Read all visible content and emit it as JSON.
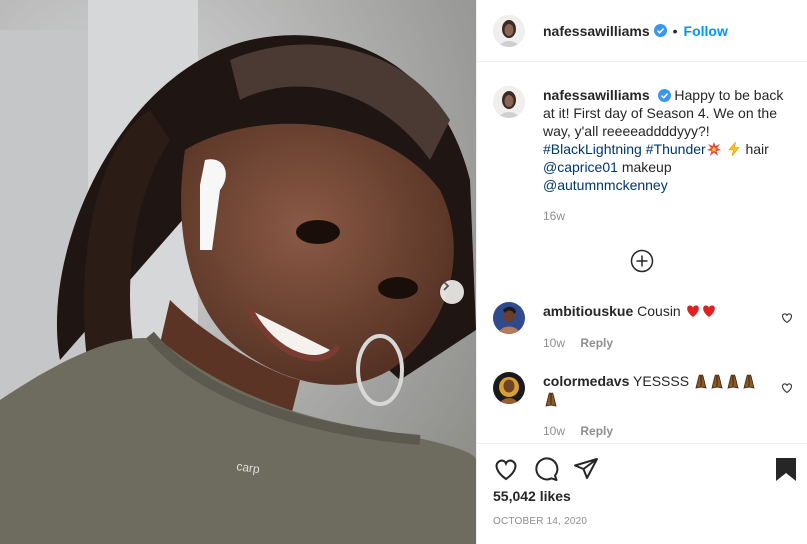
{
  "header": {
    "username": "nafessawilliams",
    "separator": "•",
    "follow_label": "Follow"
  },
  "caption": {
    "username": "nafessawilliams",
    "text_1": "Happy to be back at it! First day of Season 4. We on the way, y'all reeeeaddddyyy?!",
    "hashtag_1": "#BlackLightning",
    "hashtag_2": "#Thunder",
    "text_2": "hair",
    "mention_1": "@caprice01",
    "text_3": "makeup",
    "mention_2": "@autumnmckenney",
    "time": "16w",
    "emoji_1": "collision-icon",
    "emoji_2": "lightning-icon"
  },
  "comments": [
    {
      "username": "ambitiouskue",
      "text": "Cousin",
      "emojis": [
        "red-heart",
        "red-heart"
      ],
      "time": "10w",
      "reply_label": "Reply"
    },
    {
      "username": "colormedavs",
      "text": "YESSSS",
      "emojis": [
        "praying-hands",
        "praying-hands",
        "praying-hands",
        "praying-hands",
        "praying-hands"
      ],
      "time": "10w",
      "reply_label": "Reply"
    }
  ],
  "actions": {
    "icons": [
      "heart-icon",
      "comment-icon",
      "share-icon",
      "bookmark-icon"
    ],
    "likes": "55,042 likes",
    "date": "OCTOBER 14, 2020"
  },
  "colors": {
    "link": "#00376b",
    "follow": "#0095f6",
    "muted": "#8e8e8e",
    "verified": "#3897f0"
  }
}
